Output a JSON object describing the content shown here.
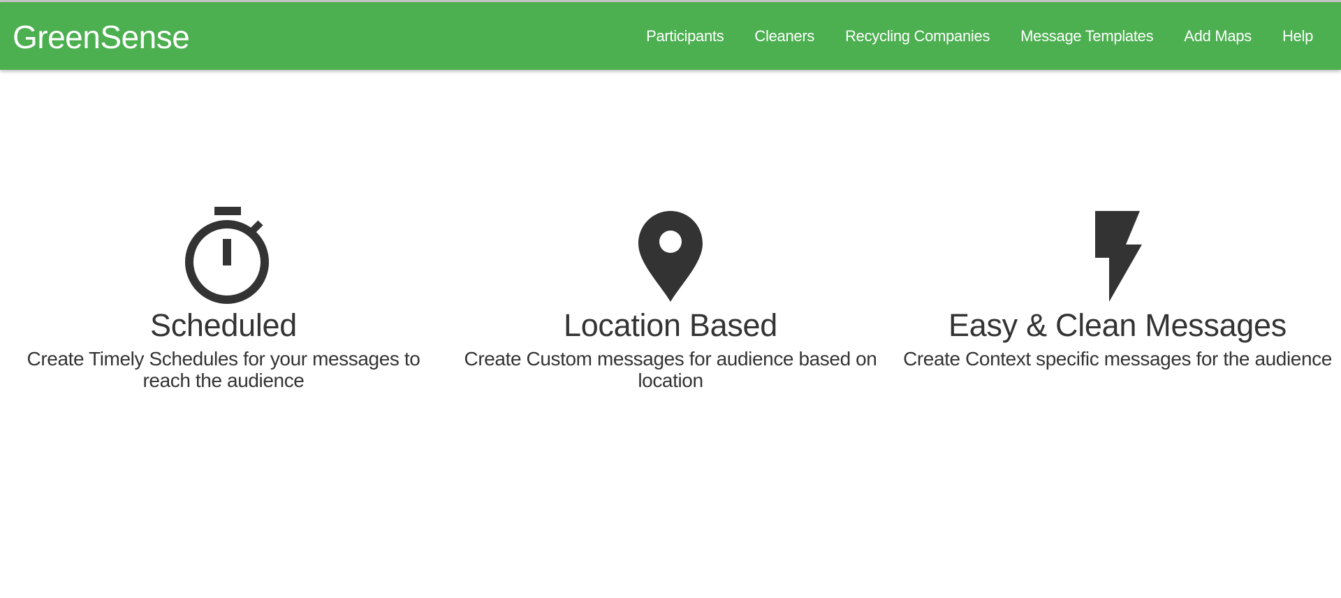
{
  "header": {
    "brand": "GreenSense",
    "nav": [
      {
        "label": "Participants"
      },
      {
        "label": "Cleaners"
      },
      {
        "label": "Recycling Companies"
      },
      {
        "label": "Message Templates"
      },
      {
        "label": "Add Maps"
      },
      {
        "label": "Help"
      }
    ]
  },
  "features": [
    {
      "icon": "stopwatch-icon",
      "title": "Scheduled",
      "description": "Create Timely Schedules for your messages to reach the audience"
    },
    {
      "icon": "map-pin-icon",
      "title": "Location Based",
      "description": "Create Custom messages for audience based on location"
    },
    {
      "icon": "lightning-bolt-icon",
      "title": "Easy & Clean Messages",
      "description": "Create Context specific messages for the audience"
    }
  ],
  "colors": {
    "navbar": "#4caf50",
    "text": "#333333",
    "nav_text": "#ffffff"
  }
}
